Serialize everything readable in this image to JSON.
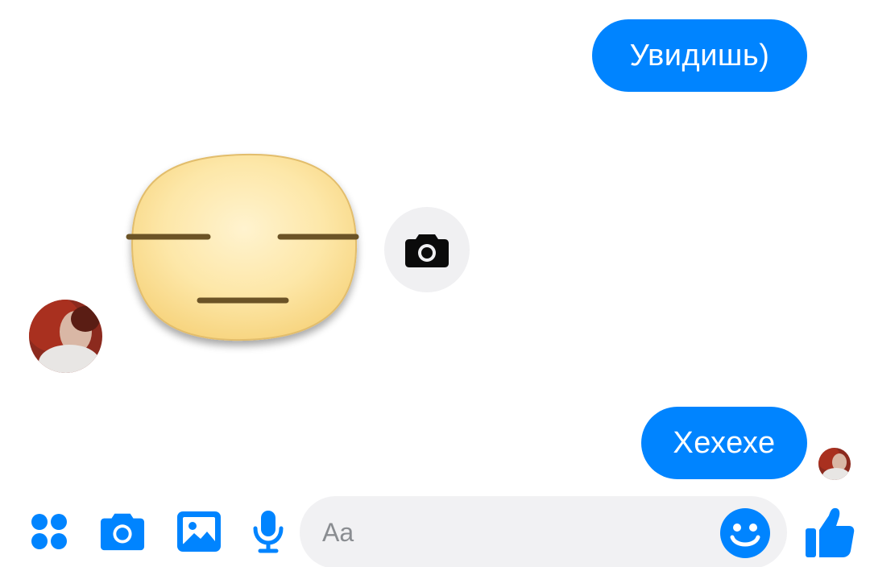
{
  "conversation": {
    "messages": [
      {
        "sender": "me",
        "type": "text",
        "text": "Увидишь)"
      },
      {
        "sender": "contact",
        "type": "sticker",
        "sticker": "expressionless-face-sticker"
      },
      {
        "sender": "me",
        "type": "text",
        "text": "Хехехе"
      }
    ]
  },
  "composer": {
    "placeholder": "Aa",
    "value": "",
    "buttons": [
      "more-actions-icon",
      "camera-icon",
      "gallery-icon",
      "microphone-icon",
      "emoji-icon",
      "thumbs-up-icon"
    ]
  },
  "colors": {
    "accent": "#0084ff",
    "input_bg": "#f1f1f3",
    "camera_circle_bg": "#f0f0f2",
    "sticker_face": "#fde7a8"
  }
}
